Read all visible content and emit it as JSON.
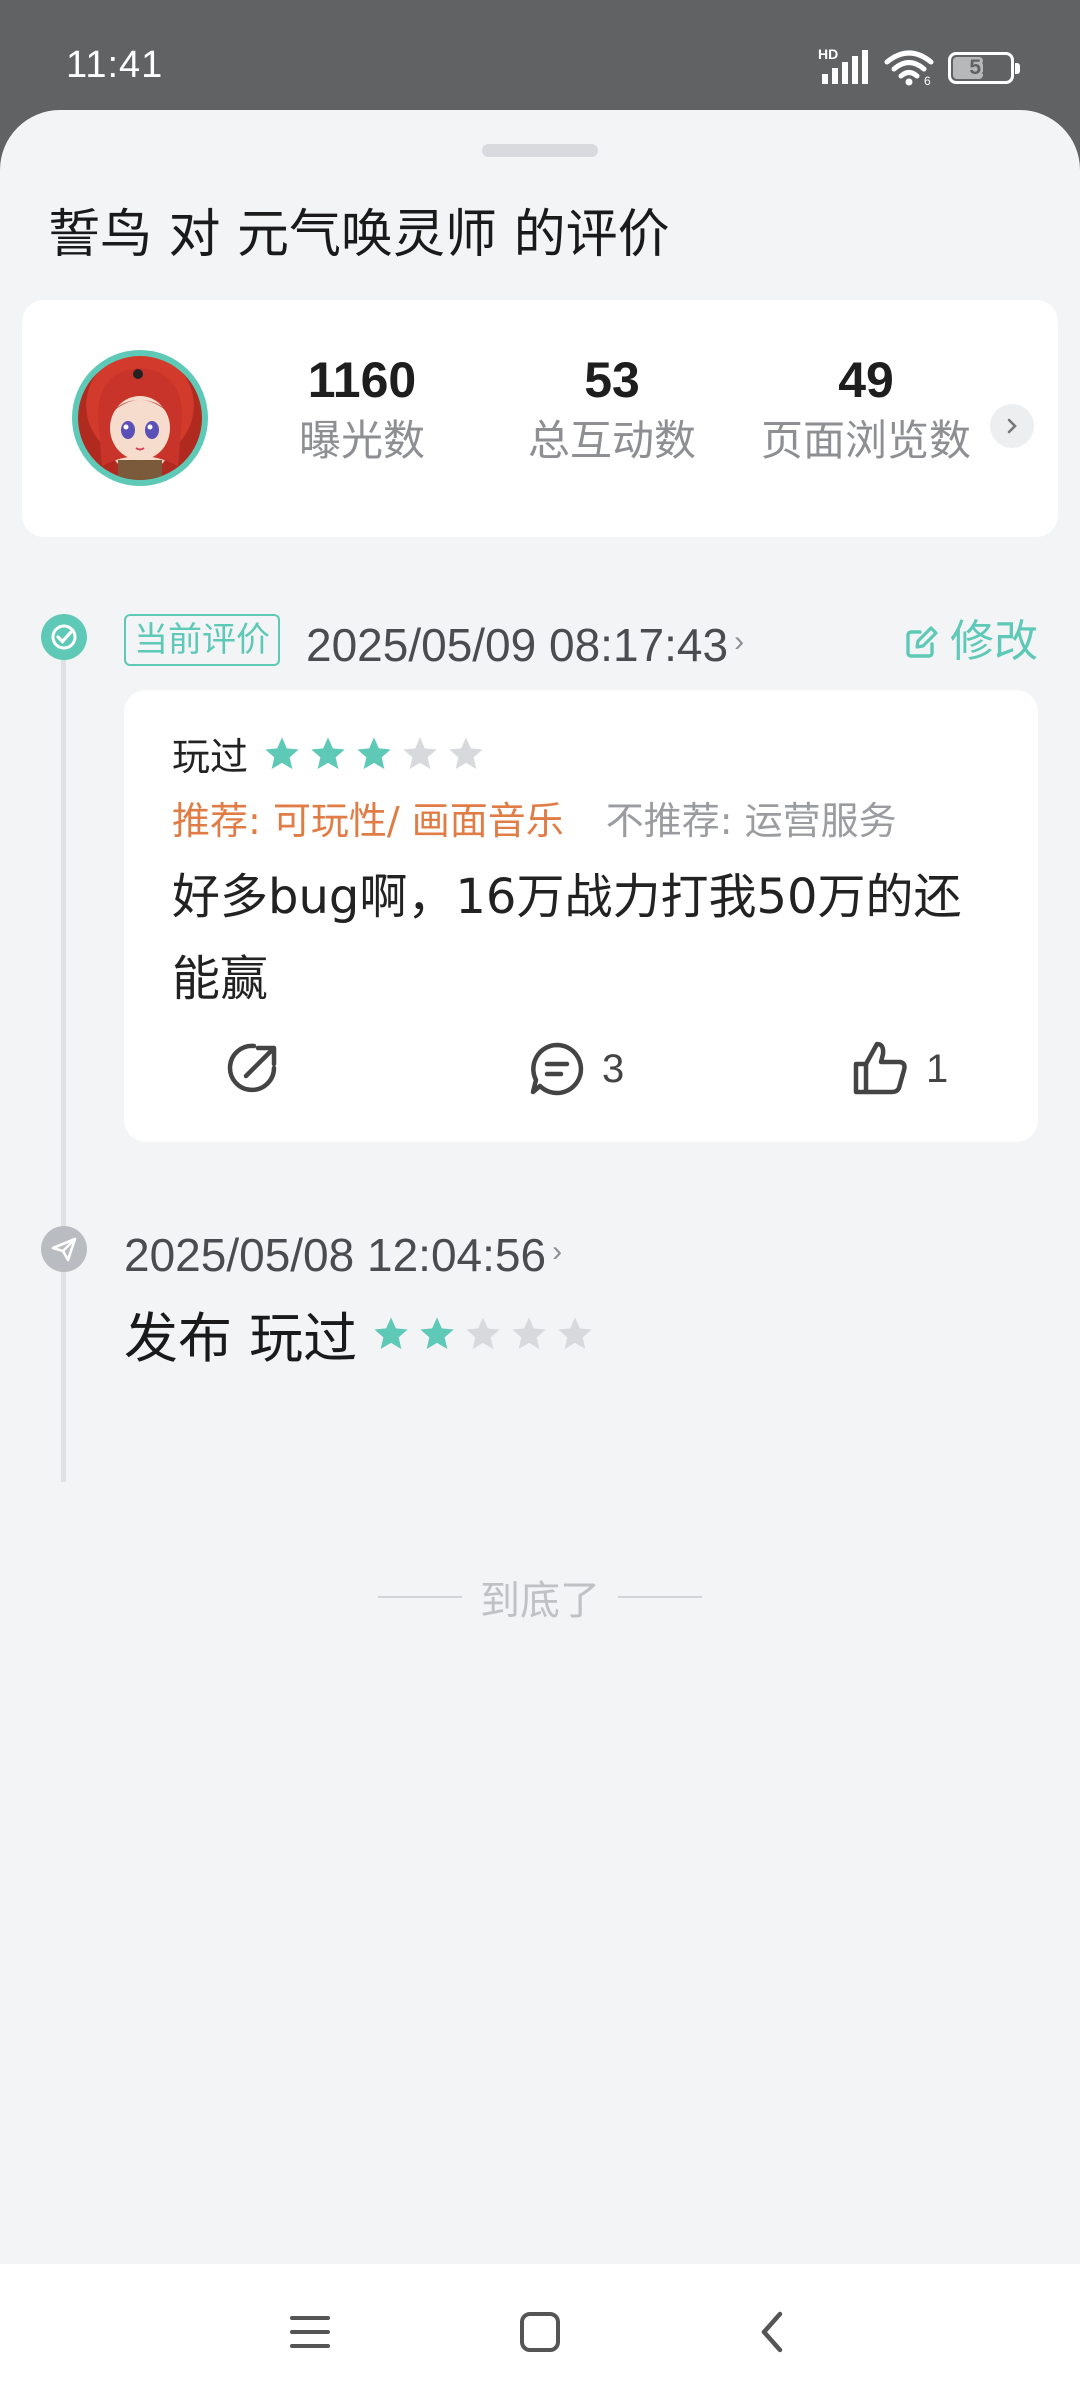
{
  "status_bar": {
    "time": "11:41",
    "network_label": "HD",
    "battery": "51",
    "icons": [
      "signal-icon",
      "wifi-icon",
      "battery-icon"
    ]
  },
  "sheet": {
    "title": "誓鸟 对 元气唤灵师 的评价"
  },
  "stats": {
    "items": [
      {
        "value": "1160",
        "label": "曝光数"
      },
      {
        "value": "53",
        "label": "总互动数"
      },
      {
        "value": "49",
        "label": "页面浏览数"
      }
    ]
  },
  "current_review": {
    "tag": "当前评价",
    "datetime": "2025/05/09 08:17:43",
    "edit_label": "修改",
    "played_label": "玩过",
    "rating": 3,
    "rating_max": 5,
    "recommend": "推荐: 可玩性/ 画面音乐",
    "not_recommend": "不推荐: 运营服务",
    "text": "好多bug啊，16万战力打我50万的还能赢",
    "comment_count": "3",
    "like_count": "1"
  },
  "earlier_review": {
    "datetime": "2025/05/08 12:04:56",
    "action_label": "发布 玩过",
    "rating": 2,
    "rating_max": 5
  },
  "footer": {
    "end_text": "到底了"
  },
  "colors": {
    "accent": "#5ec9b6",
    "recommend": "#e07c45",
    "muted": "#9a9ca0",
    "star_empty": "#d7d9dc"
  }
}
